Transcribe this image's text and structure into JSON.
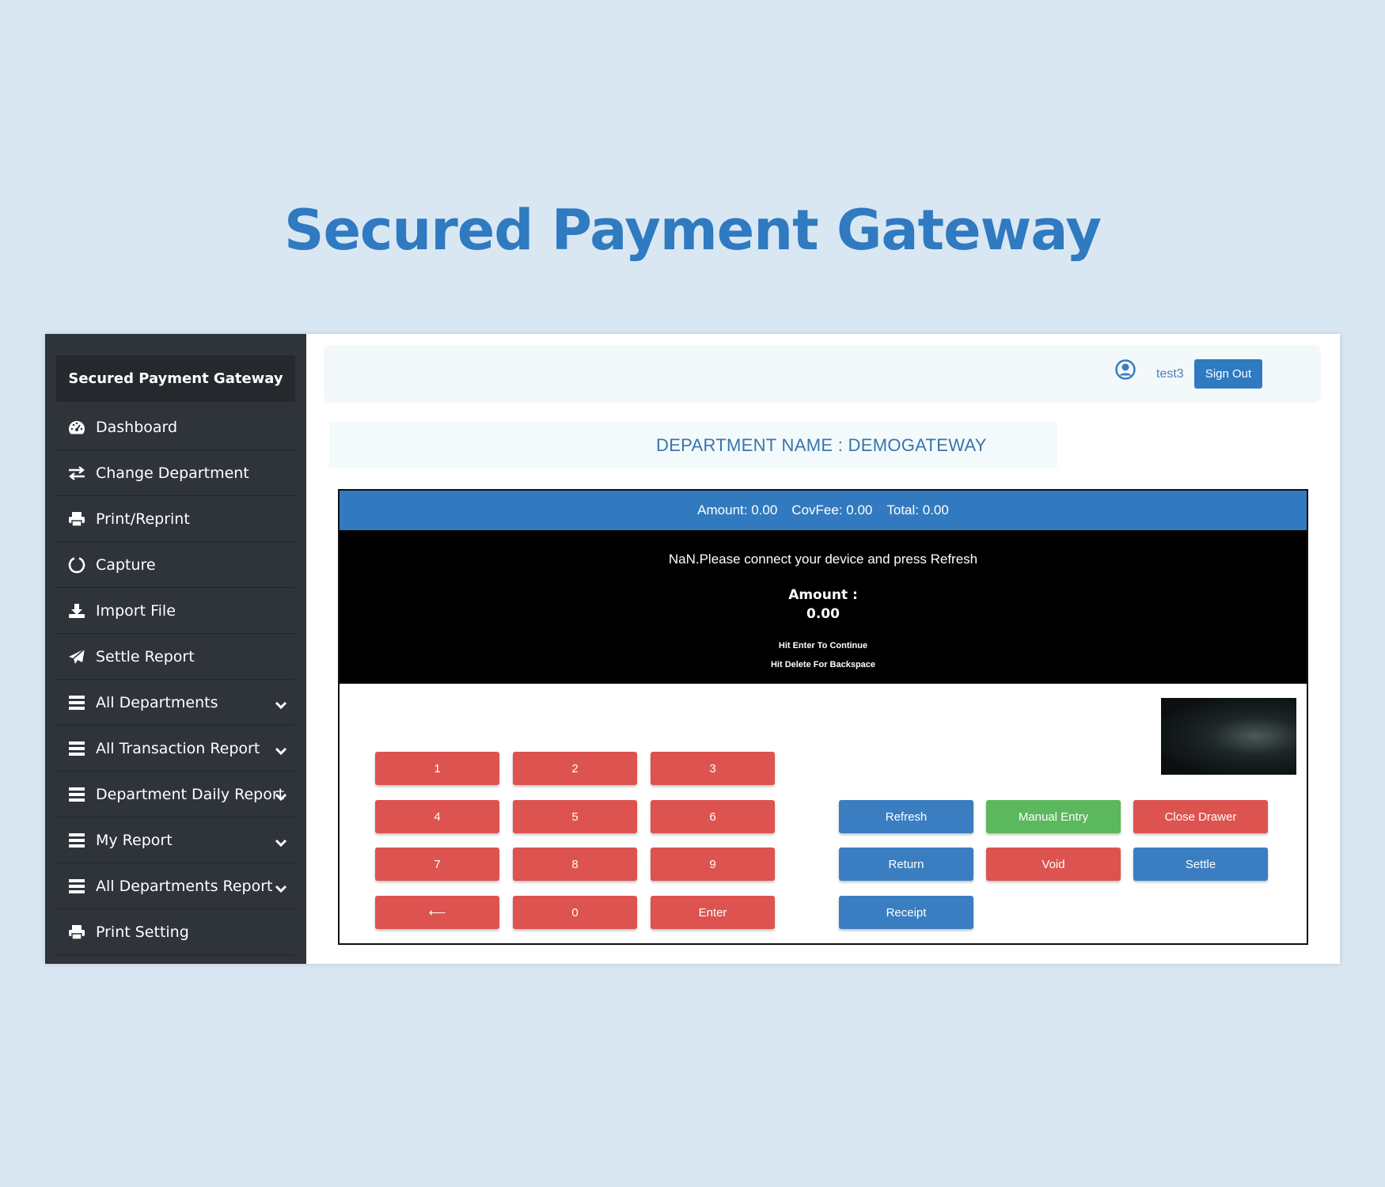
{
  "hero": {
    "title": "Secured Payment Gateway"
  },
  "sidebar": {
    "brand": "Secured Payment Gateway",
    "items": [
      {
        "label": "Dashboard",
        "icon": "dashboard-icon",
        "expandable": false
      },
      {
        "label": "Change Department",
        "icon": "exchange-icon",
        "expandable": false
      },
      {
        "label": "Print/Reprint",
        "icon": "printer-icon",
        "expandable": false
      },
      {
        "label": "Capture",
        "icon": "circle-notch-icon",
        "expandable": false
      },
      {
        "label": "Import File",
        "icon": "download-icon",
        "expandable": false
      },
      {
        "label": "Settle Report",
        "icon": "paper-plane-icon",
        "expandable": false
      },
      {
        "label": "All Departments",
        "icon": "list-icon",
        "expandable": true
      },
      {
        "label": "All Transaction Report",
        "icon": "list-icon",
        "expandable": true
      },
      {
        "label": "Department Daily Report",
        "icon": "list-icon",
        "expandable": true
      },
      {
        "label": "My Report",
        "icon": "list-icon",
        "expandable": true
      },
      {
        "label": "All Departments Report",
        "icon": "list-icon",
        "expandable": true
      },
      {
        "label": "Print Setting",
        "icon": "printer-icon",
        "expandable": false
      }
    ]
  },
  "topbar": {
    "username": "test3",
    "signout_label": "Sign Out"
  },
  "department": {
    "title": "DEPARTMENT NAME : DEMOGATEWAY"
  },
  "terminal": {
    "amount_text": "Amount: 0.00",
    "covfee_text": "CovFee: 0.00",
    "total_text": "Total: 0.00",
    "message": "NaN.Please connect your device and press Refresh",
    "amount_label": "Amount :",
    "amount_value": "0.00",
    "hint_enter": "Hit Enter To Continue",
    "hint_delete": "Hit Delete For Backspace"
  },
  "keypad": {
    "k1": "1",
    "k2": "2",
    "k3": "3",
    "k4": "4",
    "k5": "5",
    "k6": "6",
    "k7": "7",
    "k8": "8",
    "k9": "9",
    "back": "⟵",
    "k0": "0",
    "enter": "Enter"
  },
  "actions": {
    "refresh": "Refresh",
    "manual_entry": "Manual Entry",
    "close_drawer": "Close Drawer",
    "return": "Return",
    "void": "Void",
    "settle": "Settle",
    "receipt": "Receipt"
  },
  "colors": {
    "accent": "#2f7ac0",
    "sidebar": "#2f343b",
    "danger": "#dc5350",
    "success": "#5cb85c"
  }
}
